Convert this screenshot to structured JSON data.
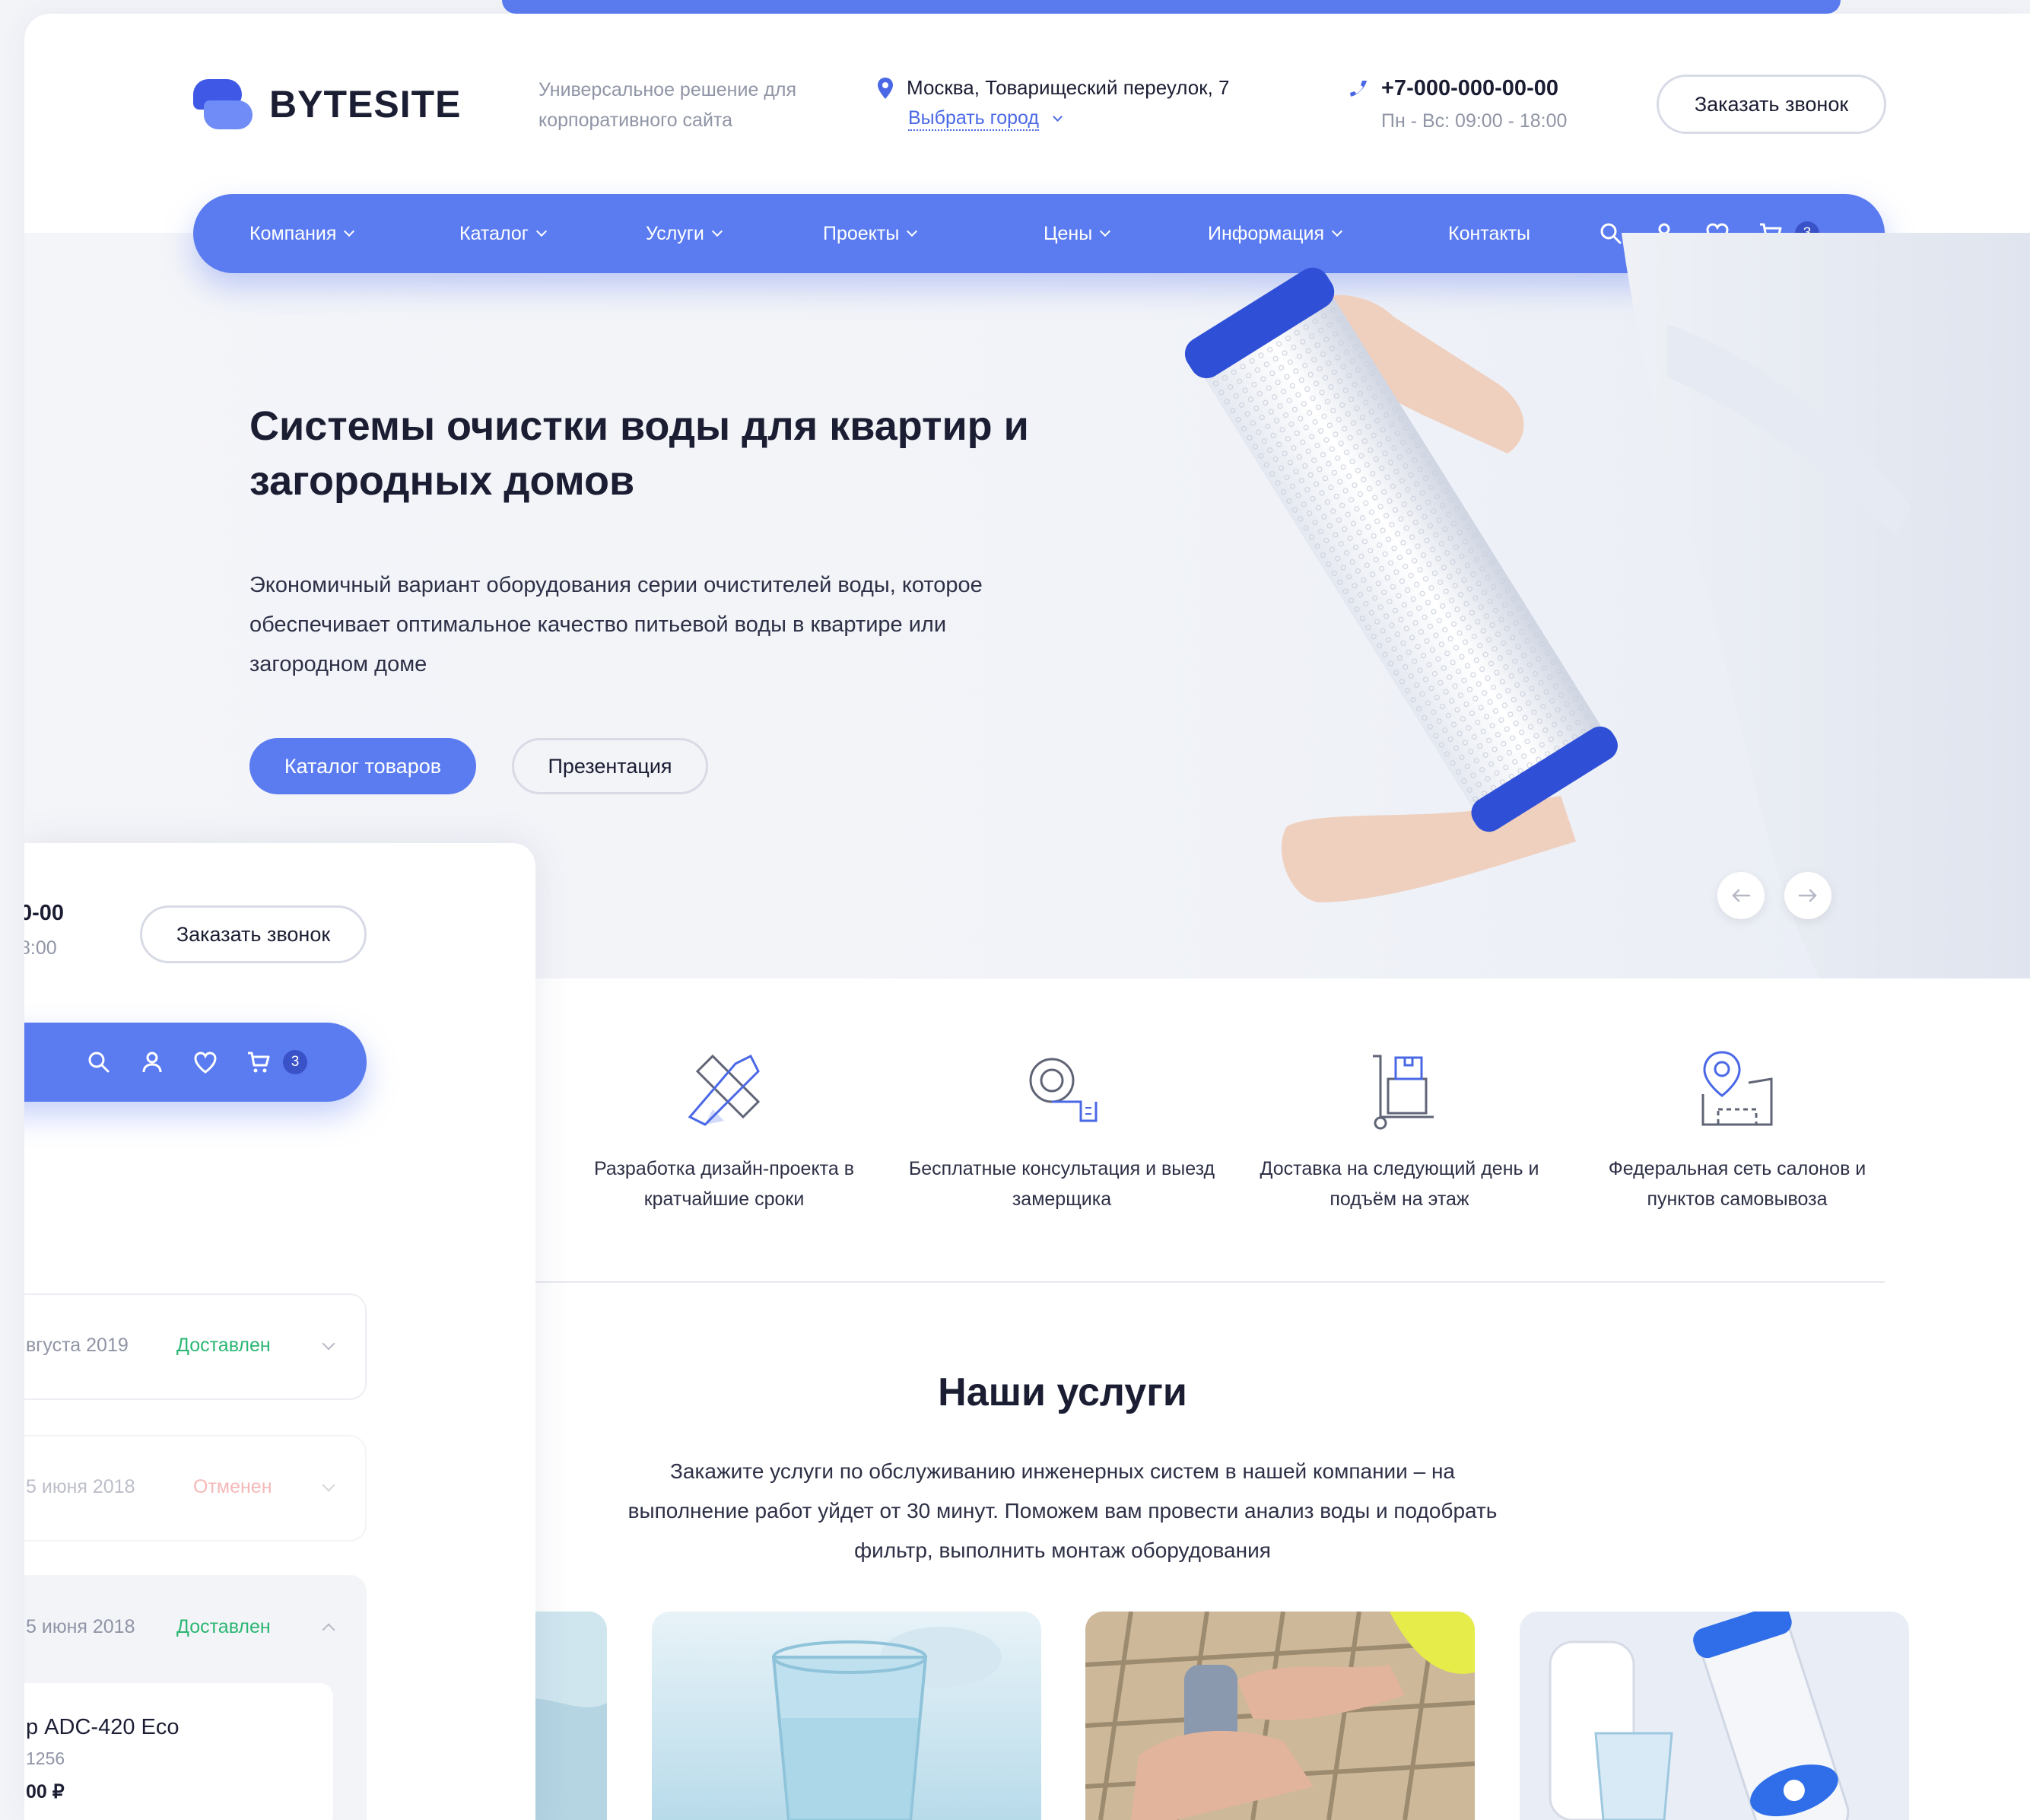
{
  "brand": {
    "name": "BYTESITE",
    "slogan": "Универсальное решение для корпоративного сайта",
    "accent": "#5b7cf0"
  },
  "header": {
    "address": "Москва, Товарищеский переулок, 7",
    "city_link": "Выбрать город",
    "phone": "+7-000-000-00-00",
    "hours": "Пн - Вс: 09:00 - 18:00",
    "callback_button": "Заказать звонок"
  },
  "nav": {
    "items": [
      {
        "label": "Компания"
      },
      {
        "label": "Каталог"
      },
      {
        "label": "Услуги"
      },
      {
        "label": "Проекты"
      },
      {
        "label": "Цены"
      },
      {
        "label": "Информация"
      },
      {
        "label": "Контакты"
      }
    ],
    "cart_count": "3",
    "icons": [
      "search-icon",
      "user-icon",
      "heart-icon",
      "cart-icon"
    ]
  },
  "hero": {
    "title": "Системы очистки воды для квартир и загородных домов",
    "text": "Экономичный вариант оборудования серии очистителей воды, которое обеспечивает оптимальное качество питьевой воды в квартире или загородном доме",
    "primary_button": "Каталог товаров",
    "secondary_button": "Презентация"
  },
  "features": [
    {
      "text": "Разработка дизайн-проекта в кратчайшие сроки",
      "icon": "design-tools-icon"
    },
    {
      "text": "Бесплатные консультация и выезд замерщика",
      "icon": "tape-measure-icon"
    },
    {
      "text": "Доставка на следующий день и подъём на этаж",
      "icon": "delivery-cart-icon"
    },
    {
      "text": "Федеральная сеть салонов и пунктов самовывоза",
      "icon": "map-location-icon"
    }
  ],
  "services": {
    "title": "Наши услуги",
    "text": "Закажите услуги по обслуживанию инженерных систем в нашей компании – на выполнение работ уйдет от 30 минут. Поможем вам провести анализ воды и подобрать фильтр, выполнить монтаж оборудования"
  },
  "overlay": {
    "phone_partial": "0-00",
    "hours_partial": "8:00",
    "callback_button": "Заказать звонок",
    "cart_count": "3",
    "orders": [
      {
        "date": "вгуста 2019",
        "status": "Доставлен",
        "status_color": "#2bb673"
      },
      {
        "date": "5 июня 2018",
        "status": "Отменен",
        "status_color": "#f08a8a"
      },
      {
        "date": "5 июня 2018",
        "status": "Доставлен",
        "status_color": "#2bb673"
      }
    ],
    "item": {
      "name": "р ADC-420 Eco",
      "code": "1256",
      "price": "00 ₽"
    }
  }
}
